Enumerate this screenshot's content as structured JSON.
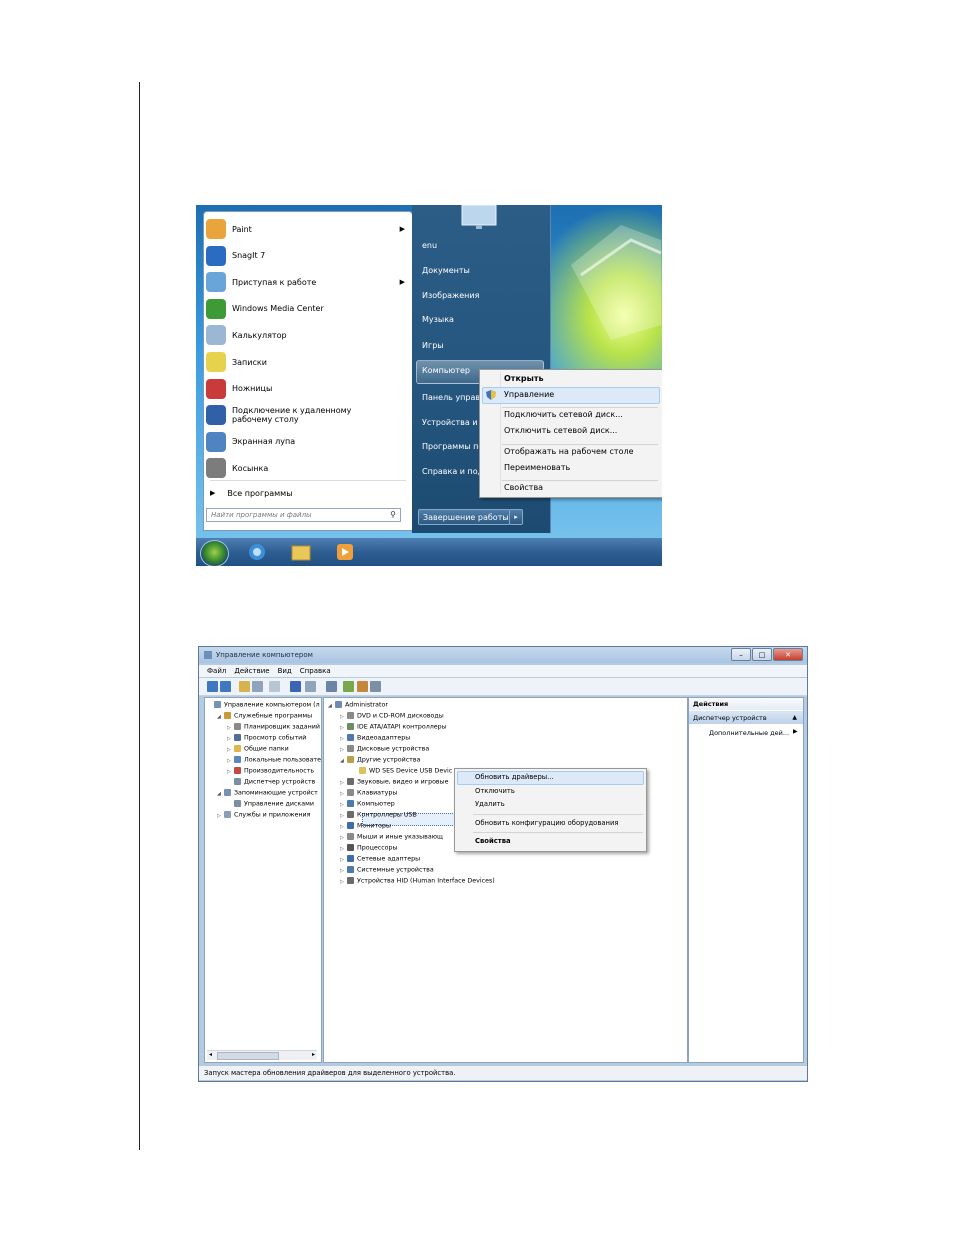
{
  "start_menu": {
    "programs": [
      {
        "label": "Paint",
        "has_arrow": true,
        "icon": "paint-icon",
        "color": "#e9a53c"
      },
      {
        "label": "SnagIt 7",
        "has_arrow": false,
        "icon": "snagit-icon",
        "color": "#2b6cc2"
      },
      {
        "label": "Приступая к работе",
        "has_arrow": true,
        "icon": "getting-started-icon",
        "color": "#6aa5d9"
      },
      {
        "label": "Windows Media Center",
        "has_arrow": false,
        "icon": "media-center-icon",
        "color": "#3e9a35"
      },
      {
        "label": "Калькулятор",
        "has_arrow": false,
        "icon": "calculator-icon",
        "color": "#9cb7d3"
      },
      {
        "label": "Записки",
        "has_arrow": false,
        "icon": "sticky-notes-icon",
        "color": "#e7d24d"
      },
      {
        "label": "Ножницы",
        "has_arrow": false,
        "icon": "scissors-icon",
        "color": "#c93a3a"
      },
      {
        "label": "Подключение к удаленному рабочему столу",
        "has_arrow": false,
        "icon": "remote-desktop-icon",
        "color": "#3061a8"
      },
      {
        "label": "Экранная лупа",
        "has_arrow": false,
        "icon": "magnifier-icon",
        "color": "#4d84c1"
      },
      {
        "label": "Косынка",
        "has_arrow": false,
        "icon": "solitaire-icon",
        "color": "#7c7c7c"
      }
    ],
    "all_programs": "Все программы",
    "search_placeholder": "Найти программы и файлы",
    "right_items": [
      "enu",
      "Документы",
      "Изображения",
      "Музыка",
      "Игры",
      "Компьютер",
      "Панель управл",
      "Устройства и п",
      "Программы по",
      "Справка и под"
    ],
    "shutdown_label": "Завершение работы",
    "context_menu": {
      "items": [
        "Открыть",
        "Управление",
        "Подключить сетевой диск...",
        "Отключить сетевой диск...",
        "Отображать на рабочем столе",
        "Переименовать",
        "Свойства"
      ],
      "highlighted": "Управление"
    }
  },
  "computer_management": {
    "title": "Управление компьютером",
    "menu": [
      "Файл",
      "Действие",
      "Вид",
      "Справка"
    ],
    "tree": [
      {
        "label": "Управление компьютером (л",
        "indent": 0,
        "twisty": "",
        "color": "#7592b3"
      },
      {
        "label": "Служебные программы",
        "indent": 1,
        "twisty": "◢",
        "color": "#c99a38"
      },
      {
        "label": "Планировщик заданий",
        "indent": 2,
        "twisty": "▷",
        "color": "#8a8a8a"
      },
      {
        "label": "Просмотр событий",
        "indent": 2,
        "twisty": "▷",
        "color": "#4f6f96"
      },
      {
        "label": "Общие папки",
        "indent": 2,
        "twisty": "▷",
        "color": "#e0b64d"
      },
      {
        "label": "Локальные пользовате",
        "indent": 2,
        "twisty": "▷",
        "color": "#5b86bf"
      },
      {
        "label": "Производительность",
        "indent": 2,
        "twisty": "▷",
        "color": "#c84a3e"
      },
      {
        "label": "Диспетчер устройств",
        "indent": 2,
        "twisty": "",
        "color": "#7c8ea3"
      },
      {
        "label": "Запоминающие устройст",
        "indent": 1,
        "twisty": "◢",
        "color": "#7592b3"
      },
      {
        "label": "Управление дисками",
        "indent": 2,
        "twisty": "",
        "color": "#7c8ea3"
      },
      {
        "label": "Службы и приложения",
        "indent": 1,
        "twisty": "▷",
        "color": "#8b9eb4"
      }
    ],
    "devices": [
      {
        "label": "Administrator",
        "indent": 0,
        "twisty": "◢",
        "color": "#6f8bb0"
      },
      {
        "label": "DVD и CD-ROM дисководы",
        "indent": 1,
        "twisty": "▷",
        "color": "#8a8a8a"
      },
      {
        "label": "IDE ATA/ATAPI контроллеры",
        "indent": 1,
        "twisty": "▷",
        "color": "#6d8c66"
      },
      {
        "label": "Видеоадаптеры",
        "indent": 1,
        "twisty": "▷",
        "color": "#4f78ad"
      },
      {
        "label": "Дисковые устройства",
        "indent": 1,
        "twisty": "▷",
        "color": "#8a8a8a"
      },
      {
        "label": "Другие устройства",
        "indent": 1,
        "twisty": "◢",
        "color": "#b8a14a"
      },
      {
        "label": "WD SES Device USB Devic",
        "indent": 2,
        "twisty": "",
        "color": "#d9c35a"
      },
      {
        "label": "Звуковые, видео и игровые",
        "indent": 1,
        "twisty": "▷",
        "color": "#6b6b6b"
      },
      {
        "label": "Клавиатуры",
        "indent": 1,
        "twisty": "▷",
        "color": "#8a8a8a"
      },
      {
        "label": "Компьютер",
        "indent": 1,
        "twisty": "▷",
        "color": "#4f78ad"
      },
      {
        "label": "Контроллеры USB",
        "indent": 1,
        "twisty": "▷",
        "color": "#6b6b6b"
      },
      {
        "label": "Мониторы",
        "indent": 1,
        "twisty": "▷",
        "color": "#3f6da8"
      },
      {
        "label": "Мыши и иные указывающ",
        "indent": 1,
        "twisty": "▷",
        "color": "#8a8a8a"
      },
      {
        "label": "Процессоры",
        "indent": 1,
        "twisty": "▷",
        "color": "#555555"
      },
      {
        "label": "Сетевые адаптеры",
        "indent": 1,
        "twisty": "▷",
        "color": "#3f6da8"
      },
      {
        "label": "Системные устройства",
        "indent": 1,
        "twisty": "▷",
        "color": "#4f78ad"
      },
      {
        "label": "Устройства HID (Human Interface Devices)",
        "indent": 1,
        "twisty": "▷",
        "color": "#6b6b6b"
      }
    ],
    "context_menu": {
      "items": [
        "Обновить драйверы...",
        "Отключить",
        "Удалить",
        "Обновить конфигурацию оборудования",
        "Свойства"
      ],
      "highlighted": "Обновить драйверы..."
    },
    "actions": {
      "header": "Действия",
      "section": "Диспетчер устройств",
      "more": "Дополнительные дей..."
    },
    "status": "Запуск мастера обновления драйверов для выделенного устройства."
  }
}
